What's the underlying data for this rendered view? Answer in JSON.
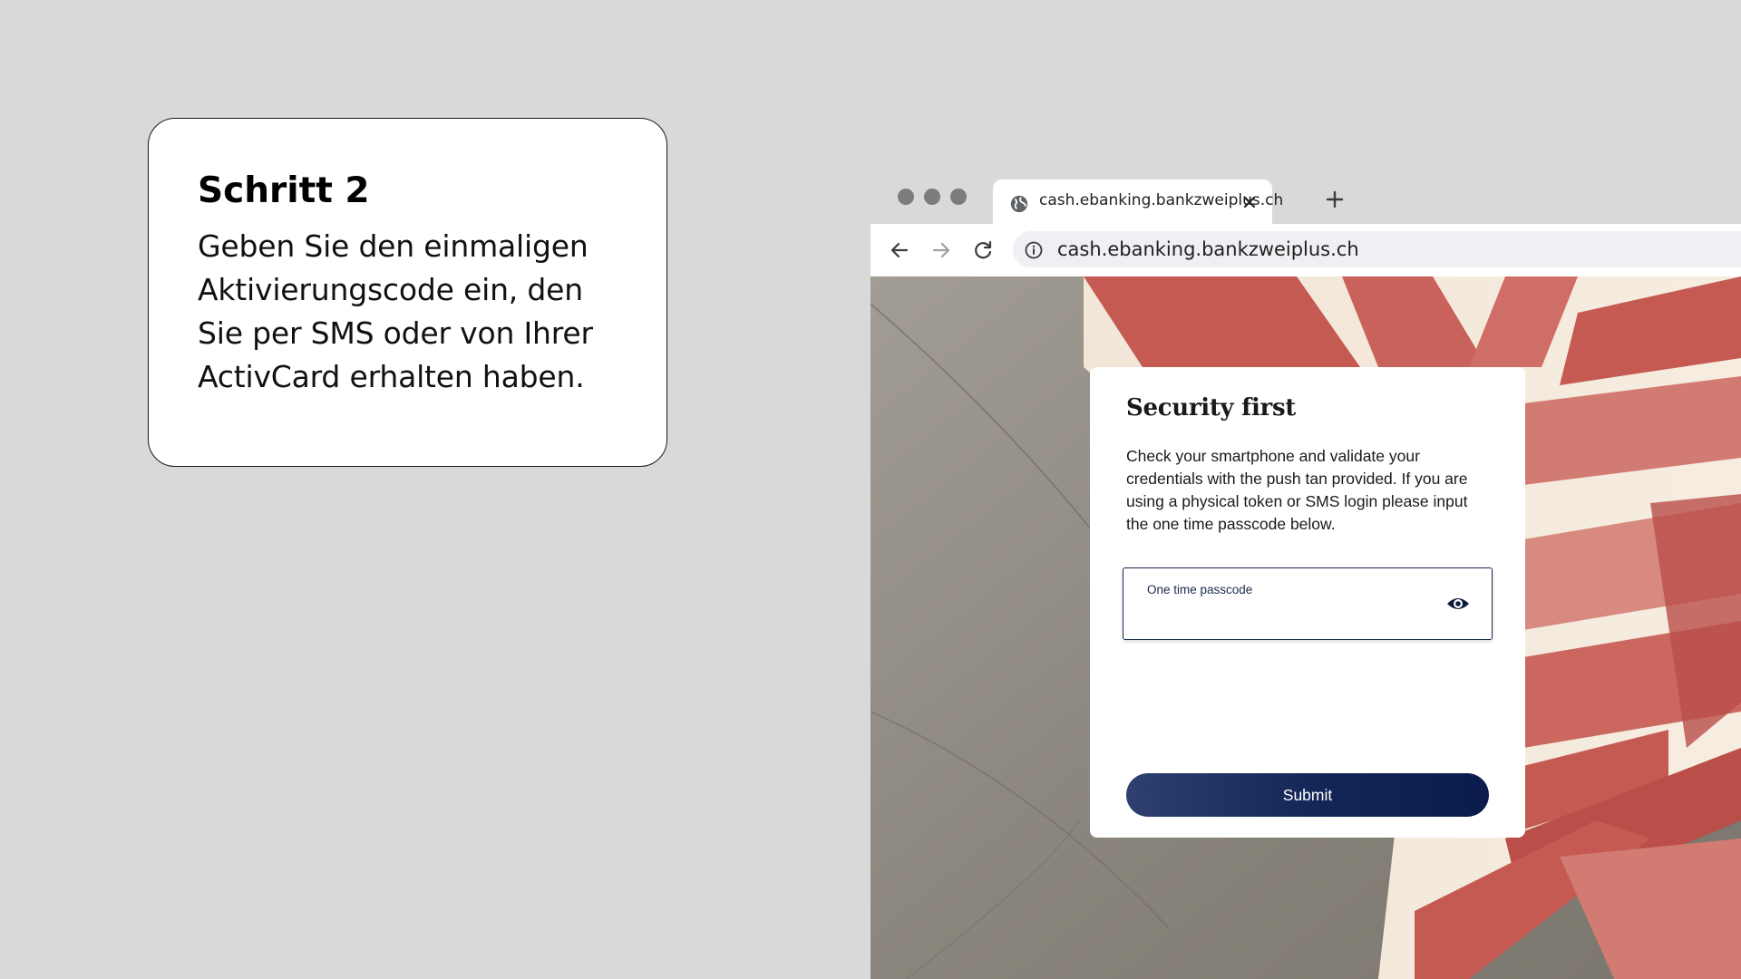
{
  "instruction": {
    "title": "Schritt 2",
    "text": "Geben Sie den einmaligen Aktivierungscode ein, den Sie per SMS oder von Ihrer ActivCard erhalten haben."
  },
  "browser": {
    "tab": {
      "title": "cash.ebanking.bankzweiplus.ch",
      "icon": "globe-icon"
    },
    "address_bar": {
      "url": "cash.ebanking.bankzweiplus.ch",
      "icon": "info-icon"
    },
    "nav_icons": [
      "back-arrow-icon",
      "forward-arrow-icon",
      "reload-icon"
    ]
  },
  "login": {
    "title": "Security first",
    "description": "Check your smartphone and validate your credentials with the push tan provided. If you are using a physical token or SMS login please input the one time passcode below.",
    "passcode_field": {
      "label": "One time passcode",
      "value": "",
      "icon": "eye-icon"
    },
    "submit_label": "Submit"
  },
  "colors": {
    "page_background": "#d9d9d9",
    "brand_navy": "#132557",
    "background_red": "#c8554e",
    "background_concrete": "#8c877e"
  }
}
